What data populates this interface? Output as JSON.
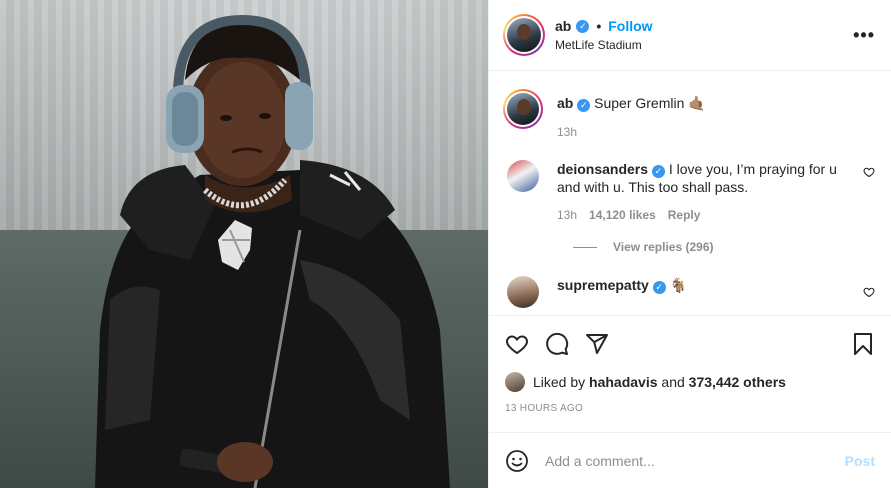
{
  "header": {
    "username": "ab",
    "separator": "•",
    "follow_label": "Follow",
    "location": "MetLife Stadium",
    "more_label": "•••"
  },
  "caption": {
    "username": "ab",
    "text": "Super Gremlin 🤙🏽",
    "time": "13h"
  },
  "comments": [
    {
      "username": "deionsanders",
      "text": "I love you, I’m praying for u and with u. This too shall pass.",
      "time": "13h",
      "likes": "14,120 likes",
      "reply_label": "Reply",
      "view_replies": "View replies (296)"
    },
    {
      "username": "supremepatty",
      "text": "🐐"
    }
  ],
  "likes": {
    "prefix": "Liked by",
    "user": "hahadavis",
    "and": "and",
    "count": "373,442 others"
  },
  "timestamp": "13 HOURS AGO",
  "add_comment": {
    "placeholder": "Add a comment...",
    "post_label": "Post"
  },
  "colors": {
    "accent": "#0095f6",
    "verified": "#3897f0",
    "muted": "#8e8e8e",
    "post_disabled": "#b2dffc"
  },
  "icons": [
    "heart-icon",
    "comment-icon",
    "share-icon",
    "bookmark-icon",
    "emoji-icon",
    "more-icon",
    "verified-badge-icon"
  ]
}
